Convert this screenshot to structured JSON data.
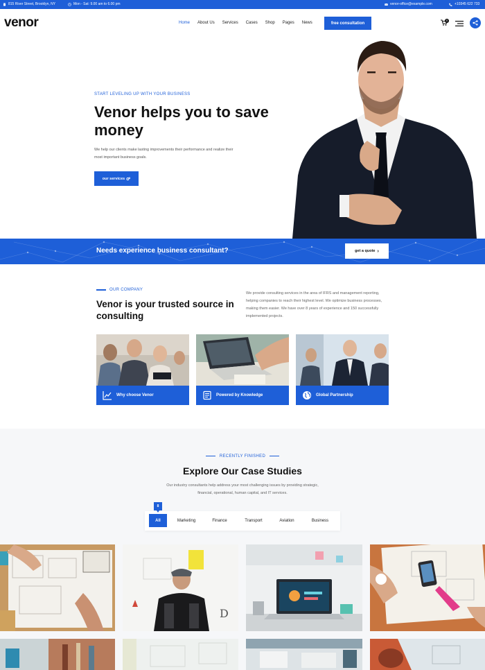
{
  "topbar": {
    "address": "815 River Street, Brooklyn, NY",
    "hours": "Mon - Sat: 9.00 am to 6.00 pm",
    "email": "venor-office@example.com",
    "phone": "+10345 622 733"
  },
  "header": {
    "logo": "venor",
    "nav": [
      "Home",
      "About Us",
      "Services",
      "Cases",
      "Shop",
      "Pages",
      "News"
    ],
    "cta": "free consultation",
    "cart_count": "0"
  },
  "hero": {
    "eyebrow": "START LEVELING UP WITH YOUR BUSINESS",
    "title": "Venor helps you to save money",
    "text": "We help our clients make lasting improvements their performance and realize their most important business goals.",
    "button": "our services"
  },
  "band": {
    "text": "Needs experience business consultant?",
    "button": "get a quote"
  },
  "company": {
    "eyebrow": "OUR COMPANY",
    "title": "Venor is your trusted source in consulting",
    "text": "We provide consulting services in the area of IFRS and management reporting, helping companies to reach their highest level. We optimize business processes, making them easier. We have over 8 years of experience and 150 successfully implemented projects.",
    "cards": [
      {
        "label": "Why choose Venor",
        "icon": "chart-icon"
      },
      {
        "label": "Powered by Knowledge",
        "icon": "book-icon"
      },
      {
        "label": "Global Partnership",
        "icon": "globe-icon"
      }
    ]
  },
  "cases": {
    "eyebrow": "RECENTLY FINISHED",
    "title": "Explore Our Case Studies",
    "text": "Our industry consultants help address your most challenging issues by providing strategic, financial, operational, human capital, and IT services.",
    "count": "8",
    "filters": [
      "All",
      "Marketing",
      "Finance",
      "Transport",
      "Aviation",
      "Business"
    ]
  },
  "colors": {
    "accent": "#1e5fd8",
    "text": "#111111",
    "section_bg": "#f6f7f9"
  }
}
